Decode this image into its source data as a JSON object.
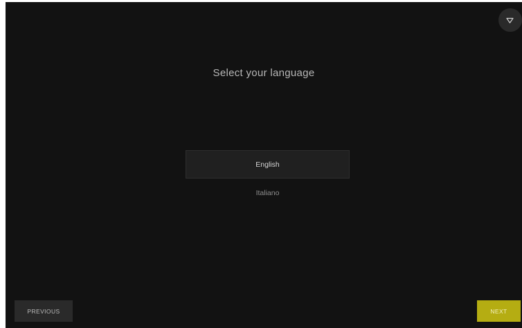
{
  "header": {
    "menu_icon": "triangle-down-icon"
  },
  "main": {
    "title": "Select your language",
    "languages": [
      {
        "label": "English",
        "selected": true
      },
      {
        "label": "Italiano",
        "selected": false
      }
    ]
  },
  "footer": {
    "previous_label": "PREVIOUS",
    "next_label": "NEXT"
  },
  "colors": {
    "background": "#121212",
    "accent": "#b5ad12",
    "selected_option_bg": "#202020",
    "button_bg": "#2a2a2a"
  }
}
